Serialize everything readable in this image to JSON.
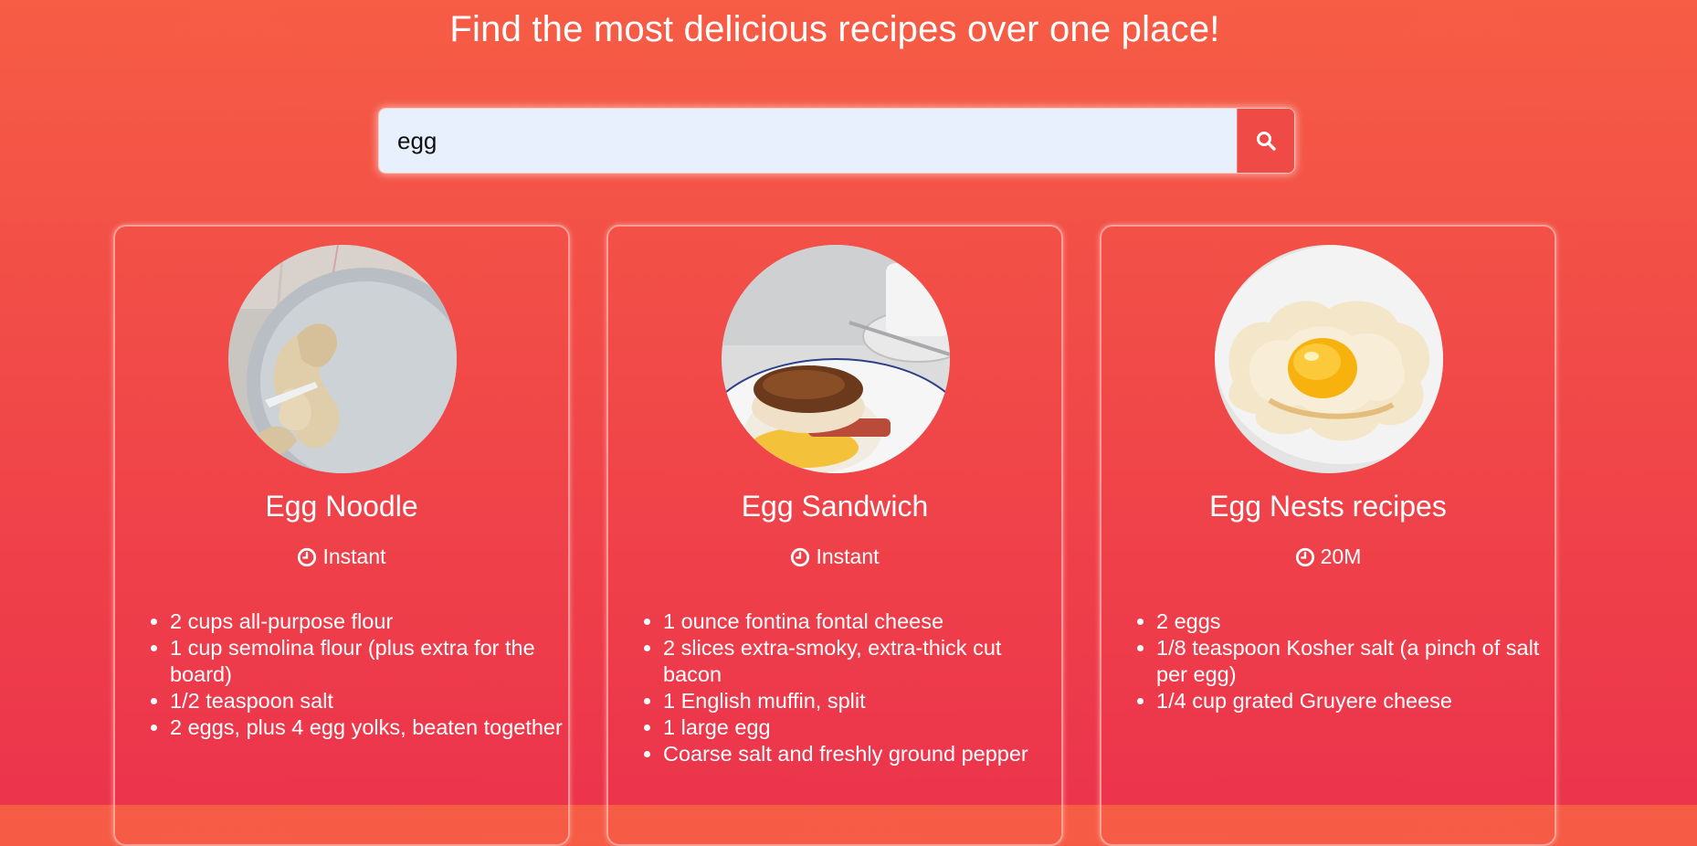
{
  "header": {
    "title": "Find the most delicious recipes over one place!"
  },
  "search": {
    "value": "egg",
    "button_icon": "search-icon"
  },
  "colors": {
    "background_top": "#f65d45",
    "background_bottom": "#ec344c",
    "search_field": "#e8f0fe",
    "text": "#ffffff"
  },
  "recipes": [
    {
      "name": "Egg Noodle",
      "time": "Instant",
      "time_icon": "clock-icon",
      "image": "egg-noodle-photo",
      "ingredients": [
        "2 cups all-purpose flour",
        "1 cup semolina flour (plus extra for the board)",
        "1/2 teaspoon salt",
        "2 eggs, plus 4 egg yolks, beaten together"
      ]
    },
    {
      "name": "Egg Sandwich",
      "time": "Instant",
      "time_icon": "clock-icon",
      "image": "egg-sandwich-photo",
      "ingredients": [
        "1 ounce fontina fontal cheese",
        "2 slices extra-smoky, extra-thick cut bacon",
        "1 English muffin, split",
        "1 large egg",
        "Coarse salt and freshly ground pepper"
      ]
    },
    {
      "name": "Egg Nests recipes",
      "time": "20M",
      "time_icon": "clock-icon",
      "image": "egg-nests-photo",
      "ingredients": [
        "2 eggs",
        "1/8 teaspoon Kosher salt (a pinch of salt per egg)",
        "1/4 cup grated Gruyere cheese"
      ]
    }
  ]
}
